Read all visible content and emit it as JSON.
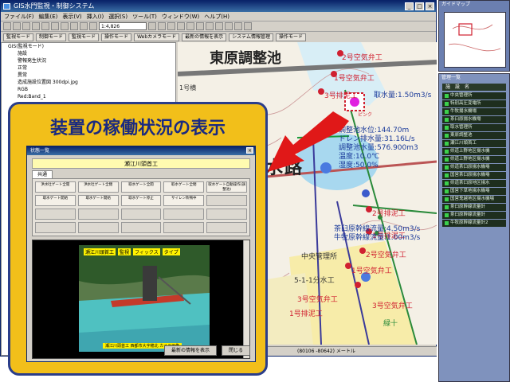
{
  "window": {
    "title": "GIS水門監視・制御システム",
    "menu": [
      "ファイル(F)",
      "編集(E)",
      "表示(V)",
      "挿入(I)",
      "選択(S)",
      "ツール(T)",
      "ウィンドウ(W)",
      "ヘルプ(H)"
    ],
    "scale": "1:4,826",
    "modes": [
      "監視モード",
      "制御モード",
      "操作モード",
      "Webカメラモード",
      "最新の情報を表示",
      "システム情報管理",
      "操作モード"
    ]
  },
  "layers": {
    "root": "GIS(監視モード)",
    "items": [
      "施設",
      "警報発生状況",
      "正常",
      "異常",
      "造成施設位置図 300dpi.jpg",
      "RGB",
      "Red:Band_1"
    ]
  },
  "map": {
    "reservoir_label": "東原調整池",
    "road_label": "疾水路",
    "measurements": [
      "取水量:1.50m3/s",
      "調整池水位:144.70m",
      "ドレン排水量:31.16L/s",
      "調整池水量:576.900m3",
      "温度:10.0℃",
      "湿度:50.0%",
      "茶臼原幹線流量:4.50m3/s",
      "牛牧原幹線流量:1.00m3/s"
    ],
    "site_labels": [
      "2号空気弁工",
      "1号空気弁工",
      "3号排泥工",
      "中央管理所",
      "2号排泥工",
      "1号排泥工",
      "2号空気弁工",
      "1号空気弁工",
      "5-1-1分水工",
      "3号空気弁工",
      "1号排泥工",
      "3号空気弁工",
      "緑十"
    ],
    "map_misc": [
      "1号横",
      "ピンク"
    ],
    "status_text": "(80106 -80642) メートル"
  },
  "guide_map": {
    "title": "ガイドマップ"
  },
  "device_list": {
    "title": "管理一覧",
    "header": "施　設　名",
    "items": [
      "中央管理所",
      "特別高圧変電所",
      "牛牧揚水機場",
      "茶臼原揚水機場",
      "取水管理所",
      "東原調整池",
      "瀬江川頭首工",
      "県道上野地区揚水機",
      "県道上野地区揚水機",
      "県道茶臼原揚水機場",
      "国営茶臼原揚水機場",
      "県道茶臼原地区揚水",
      "国営下草地揚水機場",
      "国営鬼越地区揚水機場",
      "茶臼原幹線流量計",
      "茶臼原幹線流量計",
      "牛牧原幹線流量計2"
    ]
  },
  "callout": {
    "title": "装置の稼働状況の表示",
    "window_title": "状態一覧",
    "facility_name": "瀬江川頭首工",
    "tab": "共通",
    "buttons": [
      "洪水吐ゲート全開",
      "洪水吐ゲート全閉",
      "取水ゲート全開",
      "取水ゲート全閉",
      "取水ゲート自動操作(調整池)",
      "取水ゲート開始",
      "取水ゲート開始",
      "取水ゲート停止",
      "サイレン吹鳴中",
      "",
      "",
      "",
      "",
      "",
      "",
      "",
      "",
      "",
      "",
      ""
    ],
    "camera_caption_top": [
      "瀬江川頭首工",
      "監視",
      "フィックス",
      "タイプ"
    ],
    "camera_caption_bottom": "瀬江川頭首工 西都市大字穂北 カメラ画像",
    "footer_buttons": [
      "最新の情報を表示",
      "閉じる"
    ]
  }
}
